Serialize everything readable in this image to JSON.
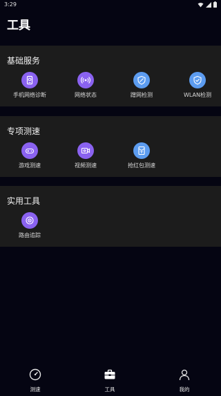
{
  "status_bar": {
    "time": "3:29"
  },
  "page": {
    "title": "工具"
  },
  "sections": [
    {
      "title": "基础服务",
      "items": [
        {
          "label": "手机网络诊断",
          "icon": "phone-diagnosis-icon"
        },
        {
          "label": "网络状态",
          "icon": "network-status-icon"
        },
        {
          "label": "蹭网检测",
          "icon": "wifi-leech-detect-icon"
        },
        {
          "label": "WLAN检测",
          "icon": "wlan-shield-icon"
        }
      ]
    },
    {
      "title": "专项测速",
      "items": [
        {
          "label": "游戏测速",
          "icon": "gamepad-icon"
        },
        {
          "label": "视频测速",
          "icon": "video-camera-icon"
        },
        {
          "label": "抢红包测速",
          "icon": "red-envelope-icon"
        }
      ]
    },
    {
      "title": "实用工具",
      "items": [
        {
          "label": "路由追踪",
          "icon": "route-trace-icon"
        }
      ]
    }
  ],
  "bottom_nav": [
    {
      "label": "测速",
      "icon": "speedometer-icon"
    },
    {
      "label": "工具",
      "icon": "toolbox-icon"
    },
    {
      "label": "我的",
      "icon": "user-icon"
    }
  ],
  "colors": {
    "background": "#050512",
    "section_bg": "#1c1c1c",
    "icon_purple": "#8a62f0",
    "icon_blue": "#5c9cf0"
  }
}
